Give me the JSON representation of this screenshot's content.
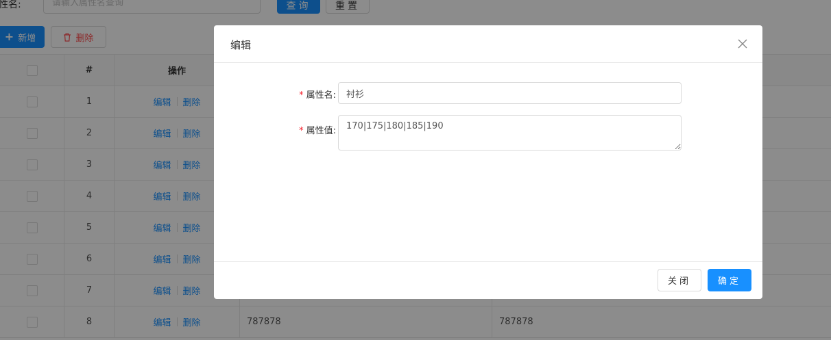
{
  "search": {
    "label": "性名:",
    "placeholder": "请输入属性名查询",
    "query_label": "查询",
    "reset_label": "重置"
  },
  "toolbar": {
    "add_label": "新增",
    "delete_label": "删除"
  },
  "table": {
    "columns": {
      "index": "#",
      "operation": "操作"
    },
    "edit_label": "编辑",
    "delete_label": "删除",
    "rows": [
      {
        "index": "1",
        "name": "",
        "value": ""
      },
      {
        "index": "2",
        "name": "",
        "value": ""
      },
      {
        "index": "3",
        "name": "",
        "value": ""
      },
      {
        "index": "4",
        "name": "",
        "value": ""
      },
      {
        "index": "5",
        "name": "",
        "value": ""
      },
      {
        "index": "6",
        "name": "",
        "value": ""
      },
      {
        "index": "7",
        "name": "",
        "value": ""
      },
      {
        "index": "8",
        "name": "787878",
        "value": "787878"
      }
    ]
  },
  "modal": {
    "title": "编辑",
    "close_icon": "close-icon",
    "fields": {
      "name": {
        "label": "属性名:",
        "value": "衬衫"
      },
      "value": {
        "label": "属性值:",
        "value": "170|175|180|185|190"
      }
    },
    "close_label": "关闭",
    "ok_label": "确定"
  },
  "colors": {
    "primary": "#1890ff",
    "danger": "#ff4d4f",
    "required": "#f5222d",
    "mask": "rgba(0,0,0,0.45)"
  }
}
